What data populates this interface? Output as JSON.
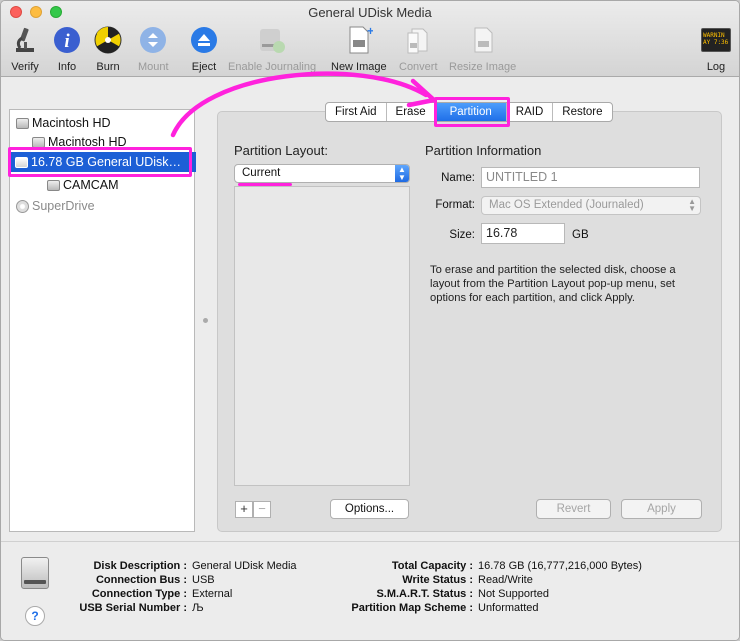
{
  "window": {
    "title": "General UDisk Media"
  },
  "toolbar": {
    "verify": "Verify",
    "info": "Info",
    "burn": "Burn",
    "mount": "Mount",
    "eject": "Eject",
    "enable_journaling": "Enable Journaling",
    "new_image": "New Image",
    "convert": "Convert",
    "resize_image": "Resize Image",
    "log": "Log",
    "log_icon_text": "WARNIN\nAY 7:36"
  },
  "sidebar": {
    "items": [
      {
        "label": "Macintosh HD",
        "icon": "hard-disk-icon"
      },
      {
        "label": "Macintosh HD",
        "icon": "volume-icon"
      },
      {
        "label": "16.78 GB General UDisk…",
        "icon": "usb-disk-icon",
        "selected": true
      },
      {
        "label": "CAMCAM",
        "icon": "volume-icon"
      },
      {
        "label": "SuperDrive",
        "icon": "optical-drive-icon",
        "disabled": true
      }
    ]
  },
  "tabs": [
    "First Aid",
    "Erase",
    "Partition",
    "RAID",
    "Restore"
  ],
  "active_tab": "Partition",
  "partition": {
    "layout_heading": "Partition Layout:",
    "layout_value": "Current",
    "info_heading": "Partition Information",
    "name_label": "Name:",
    "name_value": "UNTITLED 1",
    "format_label": "Format:",
    "format_value": "Mac OS Extended (Journaled)",
    "size_label": "Size:",
    "size_value": "16.78",
    "size_unit": "GB",
    "description": "To erase and partition the selected disk, choose a layout from the Partition Layout pop-up menu, set options for each partition, and click Apply.",
    "plus": "+",
    "minus": "−",
    "options_button": "Options...",
    "revert_button": "Revert",
    "apply_button": "Apply"
  },
  "info": {
    "left": [
      {
        "key": "Disk Description :",
        "value": "General UDisk Media"
      },
      {
        "key": "Connection Bus :",
        "value": "USB"
      },
      {
        "key": "Connection Type :",
        "value": "External"
      },
      {
        "key": "USB Serial Number :",
        "value": "Љ"
      }
    ],
    "right": [
      {
        "key": "Total Capacity :",
        "value": "16.78 GB (16,777,216,000 Bytes)"
      },
      {
        "key": "Write Status :",
        "value": "Read/Write"
      },
      {
        "key": "S.M.A.R.T. Status :",
        "value": "Not Supported"
      },
      {
        "key": "Partition Map Scheme :",
        "value": "Unformatted"
      }
    ],
    "help": "?"
  },
  "colors": {
    "accent": "#1f6fe8",
    "annotation": "#ff22dd",
    "selection": "#1c5fd6"
  }
}
